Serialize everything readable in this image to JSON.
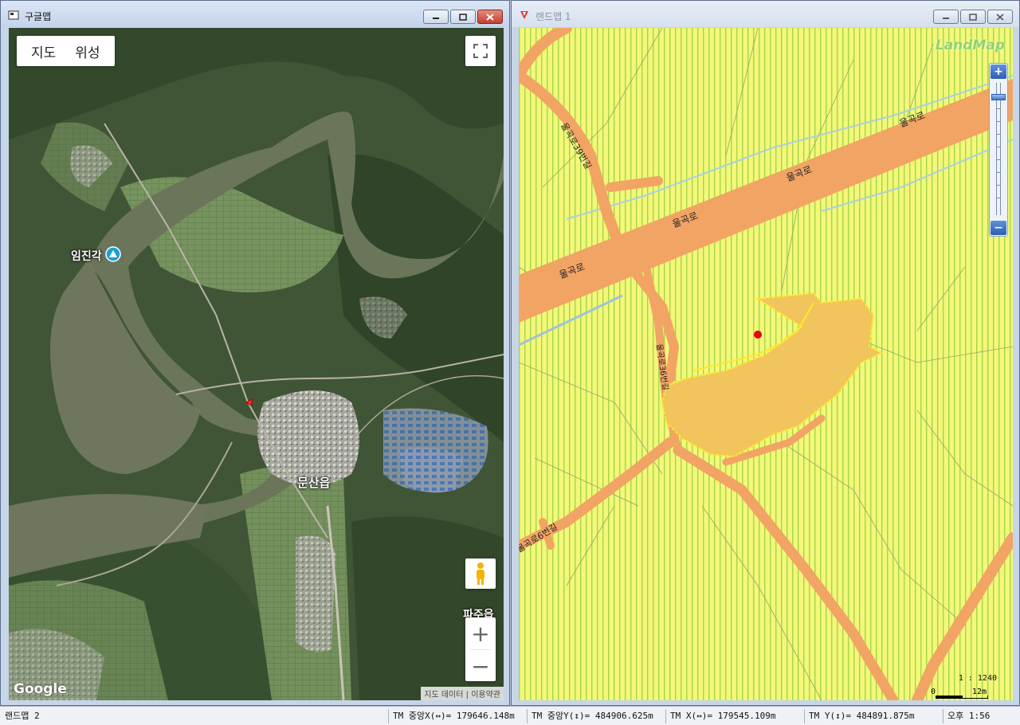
{
  "left_window": {
    "title": "구글맵",
    "map_type": {
      "map_label": "지도",
      "satellite_label": "위성"
    },
    "places": [
      {
        "name": "임진각"
      },
      {
        "name": "문산읍"
      },
      {
        "name": "파주읍"
      }
    ],
    "logo": "Google",
    "attribution": {
      "data": "지도 데이터",
      "divider": "|",
      "terms": "이용약관"
    },
    "zoom": {
      "in": "+",
      "out": "−"
    },
    "icons": {
      "fullscreen": "fullscreen-icon",
      "pegman": "pegman-icon",
      "place": "landmark-pin-icon"
    }
  },
  "right_window": {
    "title": "랜드맵 1",
    "logo": "LandMap",
    "road_labels": {
      "r1": "울곡로",
      "r2": "울곡로",
      "r3": "울곡로",
      "r4": "울곡로",
      "r5": "울곡로39번길",
      "r6": "울곡로6번길",
      "r7": "울곡로36번길"
    },
    "scale": {
      "ratio": "1 : 1240",
      "zero": "0",
      "distance": "12m"
    },
    "zoom": {
      "in": "+",
      "out": "−"
    },
    "colors": {
      "zone_yellow": "#f3f77a",
      "zone_stripe": "#a6d548",
      "road": "#f2a464",
      "parcel": "#f1c45d",
      "parcel_border": "#ffe82a",
      "marker": "#e8000b"
    }
  },
  "status_bar": {
    "app": "랜드맵 2",
    "tm_center_x": "TM 중앙X(↔)= 179646.148m",
    "tm_center_y": "TM 중앙Y(↕)= 484906.625m",
    "tm_x": "TM X(↔)= 179545.109m",
    "tm_y": "TM Y(↕)= 484891.875m",
    "clock": "오후 1:56"
  }
}
